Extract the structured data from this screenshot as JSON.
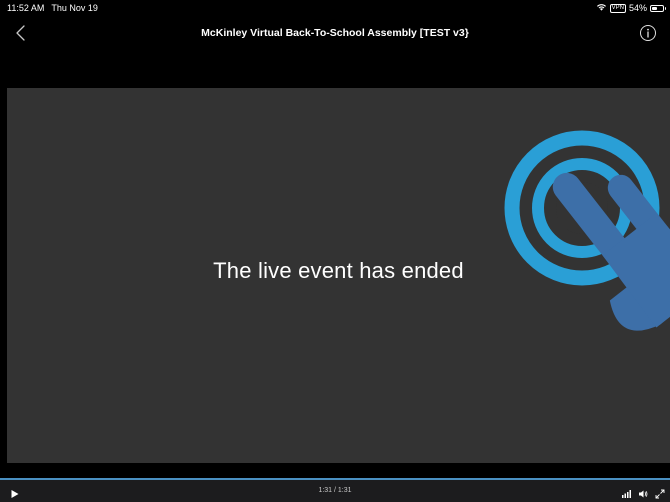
{
  "status_bar": {
    "time": "11:52 AM",
    "date": "Thu Nov 19",
    "vpn_label": "VPN",
    "battery_percent": "54%",
    "battery_level": 0.54,
    "wifi_icon": "wifi-icon",
    "battery_icon": "battery-icon"
  },
  "nav": {
    "title": "McKinley Virtual Back-To-School Assembly [TEST v3}",
    "back_icon": "chevron-left-icon",
    "info_icon": "info-circle-icon"
  },
  "video": {
    "message": "The live event has ended",
    "logo_icon": "touch-tap-logo-icon",
    "colors": {
      "background": "#333333",
      "logo_ring": "#2a9fd6",
      "logo_hand": "#3d6fa8"
    }
  },
  "controls": {
    "time": "1:31 / 1:31",
    "progress": 1.0,
    "play_icon": "play-icon",
    "quality_icon": "signal-bars-icon",
    "volume_icon": "speaker-icon",
    "fullscreen_icon": "expand-icon",
    "accent_color": "#4a90c2"
  }
}
